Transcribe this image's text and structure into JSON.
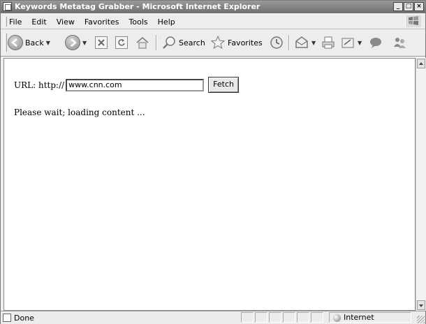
{
  "window": {
    "title": "Keywords Metatag Grabber - Microsoft Internet Explorer"
  },
  "menubar": {
    "items": [
      {
        "label": "File"
      },
      {
        "label": "Edit"
      },
      {
        "label": "View"
      },
      {
        "label": "Favorites"
      },
      {
        "label": "Tools"
      },
      {
        "label": "Help"
      }
    ]
  },
  "toolbar": {
    "back_label": "Back",
    "search_label": "Search",
    "favorites_label": "Favorites",
    "icons": [
      "back-icon",
      "forward-icon",
      "stop-icon",
      "refresh-icon",
      "home-icon",
      "search-icon",
      "favorites-icon",
      "history-icon",
      "mail-icon",
      "print-icon",
      "edit-icon",
      "discuss-icon",
      "messenger-icon"
    ]
  },
  "content": {
    "url_label": "URL: http://",
    "url_value": "www.cnn.com",
    "fetch_label": "Fetch",
    "status_message": "Please wait; loading content ..."
  },
  "statusbar": {
    "text": "Done",
    "zone": "Internet"
  }
}
